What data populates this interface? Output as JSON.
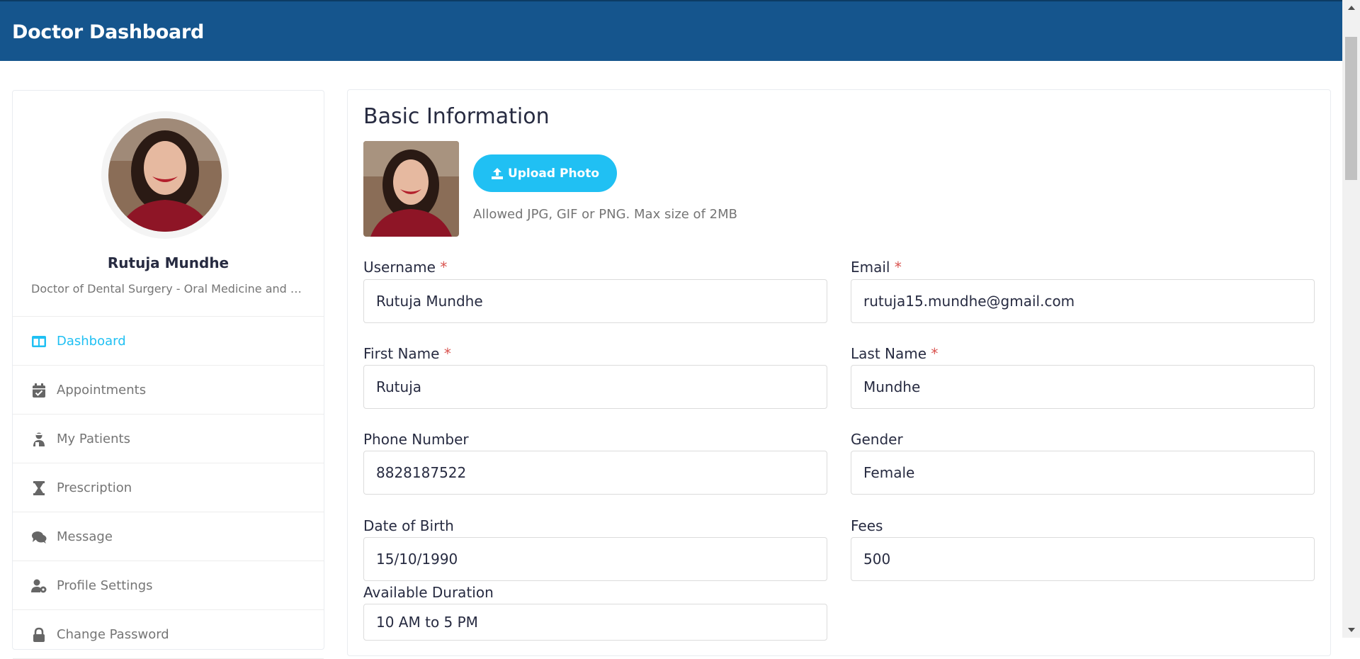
{
  "header": {
    "title": "Doctor Dashboard"
  },
  "profile": {
    "name": "Rutuja Mundhe",
    "specialty": "Doctor of Dental Surgery - Oral Medicine and Radiology"
  },
  "sidebar": {
    "items": [
      {
        "label": "Dashboard",
        "icon": "columns-icon",
        "active": true
      },
      {
        "label": "Appointments",
        "icon": "calendar-check-icon",
        "active": false
      },
      {
        "label": "My Patients",
        "icon": "user-injured-icon",
        "active": false
      },
      {
        "label": "Prescription",
        "icon": "hourglass-icon",
        "active": false
      },
      {
        "label": "Message",
        "icon": "comments-icon",
        "active": false
      },
      {
        "label": "Profile Settings",
        "icon": "user-cog-icon",
        "active": false
      },
      {
        "label": "Change Password",
        "icon": "lock-icon",
        "active": false
      }
    ]
  },
  "basic_info": {
    "title": "Basic Information",
    "upload_button": "Upload Photo",
    "upload_note": "Allowed JPG, GIF or PNG. Max size of 2MB"
  },
  "form": {
    "username": {
      "label": "Username",
      "value": "Rutuja Mundhe",
      "required": "*"
    },
    "email": {
      "label": "Email",
      "value": "rutuja15.mundhe@gmail.com",
      "required": "*"
    },
    "first_name": {
      "label": "First Name",
      "value": "Rutuja",
      "required": "*"
    },
    "last_name": {
      "label": "Last Name",
      "value": "Mundhe",
      "required": "*"
    },
    "phone": {
      "label": "Phone Number",
      "value": "8828187522"
    },
    "gender": {
      "label": "Gender",
      "value": "Female"
    },
    "dob": {
      "label": "Date of Birth",
      "value": "15/10/1990"
    },
    "fees": {
      "label": "Fees",
      "value": "500"
    },
    "duration": {
      "label": "Available Duration",
      "value": "10 AM to 5 PM"
    }
  },
  "colors": {
    "header": "#15558d",
    "accent": "#20c0f3",
    "required": "#d9534f"
  }
}
